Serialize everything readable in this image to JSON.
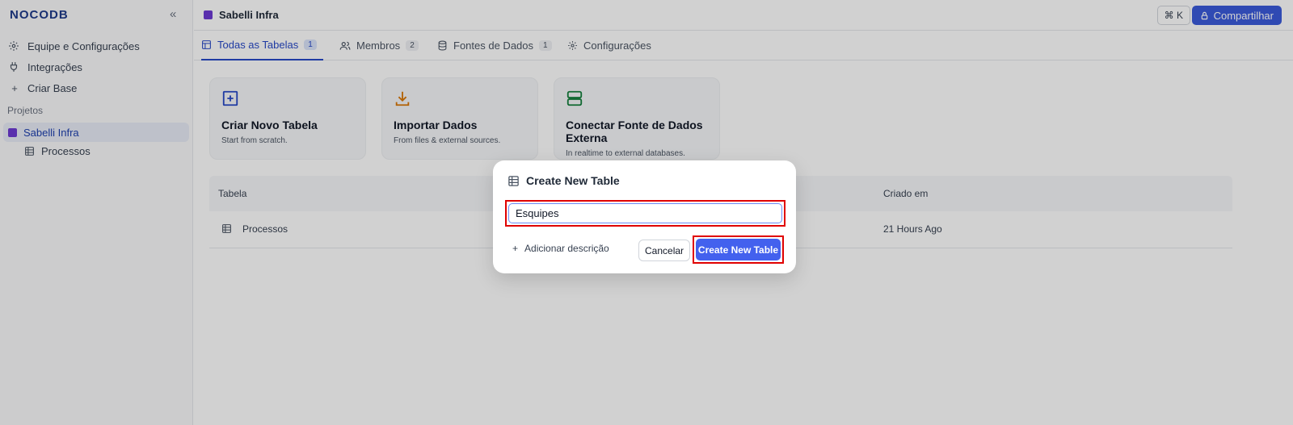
{
  "sidebar": {
    "logo": "NOCODB",
    "items": [
      {
        "label": "Equipe e Configurações",
        "icon": "gear-icon"
      },
      {
        "label": "Integrações",
        "icon": "plug-icon"
      },
      {
        "label": "Criar Base",
        "icon": "plus-icon"
      }
    ],
    "section_label": "Projetos",
    "project": "Sabelli Infra",
    "table": "Processos"
  },
  "topbar": {
    "project": "Sabelli Infra",
    "shortcut": "⌘ K",
    "share": "Compartilhar"
  },
  "tabs": [
    {
      "label": "Todas as Tabelas",
      "count": "1"
    },
    {
      "label": "Membros",
      "count": "2"
    },
    {
      "label": "Fontes de Dados",
      "count": "1"
    },
    {
      "label": "Configurações",
      "count": ""
    }
  ],
  "cards": [
    {
      "title": "Criar Novo Tabela",
      "sub": "Start from scratch."
    },
    {
      "title": "Importar Dados",
      "sub": "From files & external sources."
    },
    {
      "title": "Conectar Fonte de Dados Externa",
      "sub": "In realtime to external databases."
    }
  ],
  "table": {
    "col1": "Tabela",
    "col2": "Criado em",
    "row": {
      "name": "Processos",
      "created": "21 Hours Ago"
    }
  },
  "modal": {
    "title": "Create New Table",
    "input_value": "Esquipes",
    "add_description": "Adicionar descrição",
    "cancel": "Cancelar",
    "create": "Create New Table"
  },
  "colors": {
    "accent": "#3b5bdb",
    "highlight": "#e00000"
  }
}
